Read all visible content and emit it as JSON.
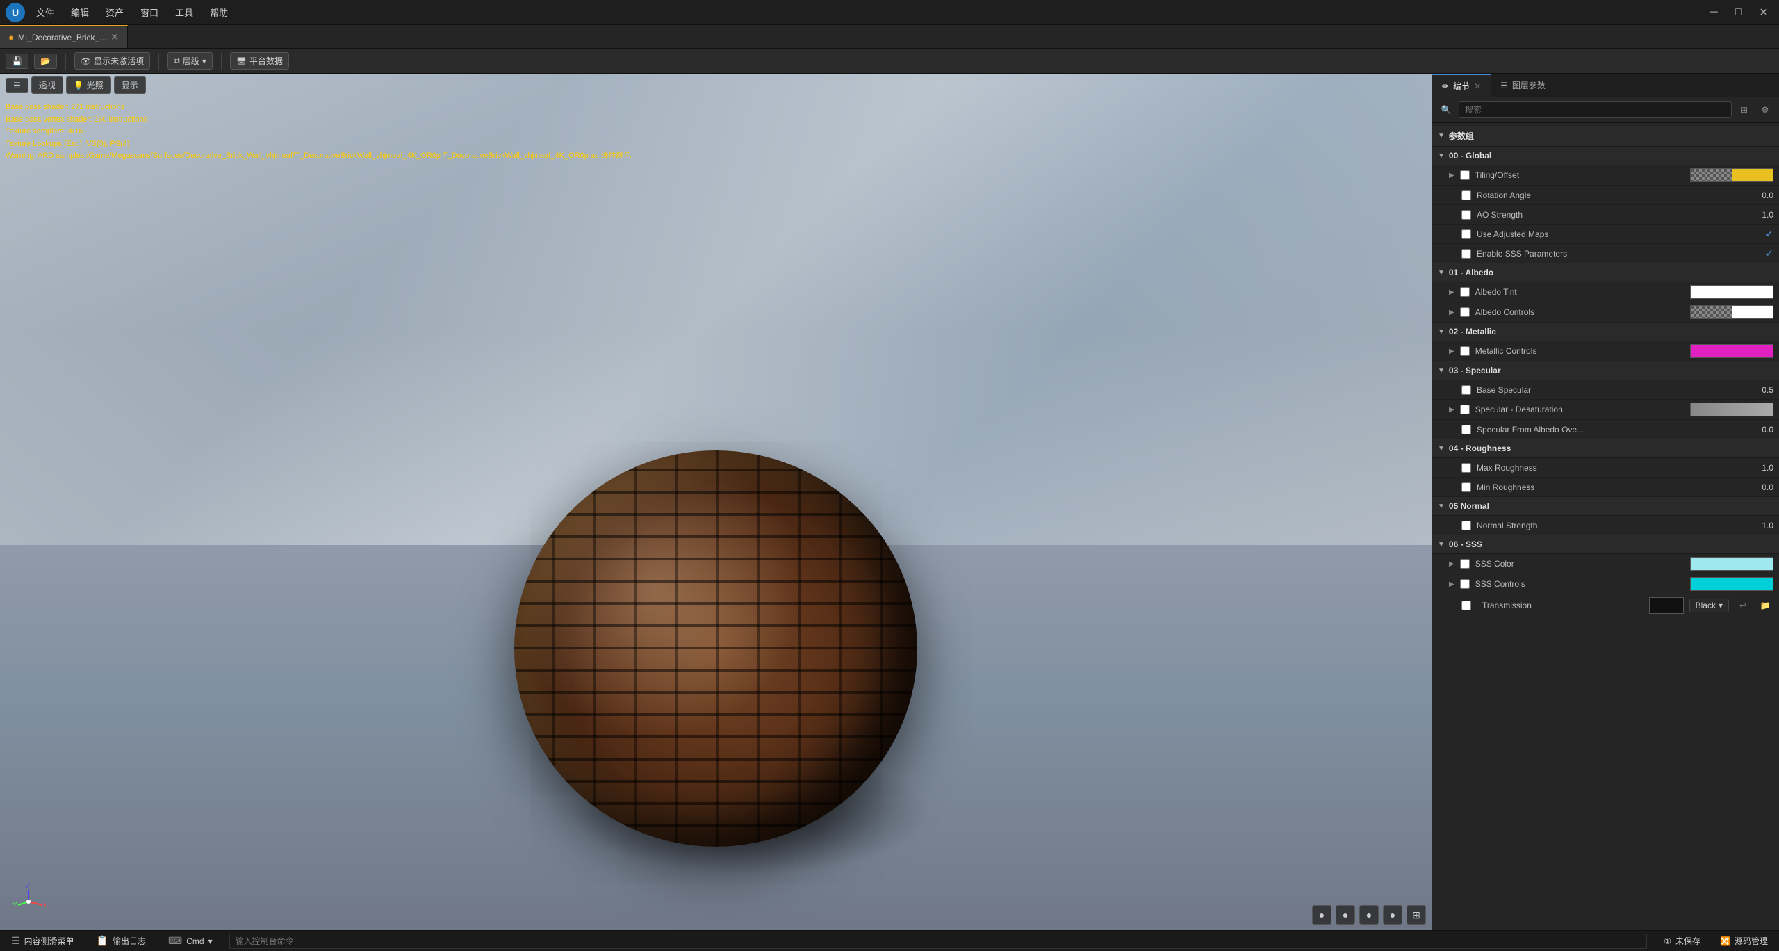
{
  "titleBar": {
    "logo": "U",
    "menus": [
      "文件",
      "编辑",
      "资产",
      "窗口",
      "工具",
      "帮助"
    ],
    "winControls": [
      "—",
      "☐",
      "✕"
    ]
  },
  "tabs": [
    {
      "label": "MI_Decorative_Brick_...",
      "active": true
    }
  ],
  "toolbar": {
    "saveBtn": "💾",
    "openBtn": "📁",
    "showUnactivated": "显示未激活项",
    "layerLabel": "层级",
    "platformData": "平台数据"
  },
  "viewport": {
    "perspBtn": "透视",
    "lightingBtn": "光照",
    "showBtn": "显示",
    "debugLines": [
      "Base pass shader: 271 instructions",
      "Base pass vertex shader: 260 instructions",
      "Texture samplers: 4/16",
      "Texture Lookups (Est.): VS(3), PS(4)"
    ],
    "warningLine": "Warning: ARD samples /Game/Megascans/Surfaces/Decorative_Brick_Wall_vhjmeaf/T_DecorativeBrickWall_vhjmeaf_4K_OR0p T_DecorativeBrickWall_vhjmeaf_4K_OR0p as 线性颜色",
    "bottomBtns": [
      "●",
      "●",
      "●",
      "●",
      "⊞"
    ]
  },
  "rightPanel": {
    "tabs": [
      {
        "label": "编节",
        "active": true,
        "icon": "✏"
      },
      {
        "label": "图层参数",
        "active": false,
        "icon": "☰"
      }
    ],
    "search": {
      "placeholder": "搜索"
    },
    "sections": {
      "header": "参数组",
      "groups": [
        {
          "id": "global",
          "label": "00 - Global",
          "expanded": true,
          "params": [
            {
              "id": "tiling",
              "label": "Tiling/Offset",
              "type": "swatch-tiling",
              "hasArrow": true
            },
            {
              "id": "rotation",
              "label": "Rotation Angle",
              "type": "number",
              "value": "0.0"
            },
            {
              "id": "ao",
              "label": "AO Strength",
              "type": "number",
              "value": "1.0"
            },
            {
              "id": "adjusted",
              "label": "Use Adjusted Maps",
              "type": "checkbox-check",
              "checked": true
            },
            {
              "id": "sss-enable",
              "label": "Enable SSS Parameters",
              "type": "checkbox-check",
              "checked": true
            }
          ]
        },
        {
          "id": "albedo",
          "label": "01 - Albedo",
          "expanded": true,
          "params": [
            {
              "id": "albedo-tint",
              "label": "Albedo Tint",
              "type": "swatch-white",
              "hasArrow": true
            },
            {
              "id": "albedo-controls",
              "label": "Albedo Controls",
              "type": "swatch-checker",
              "hasArrow": true
            }
          ]
        },
        {
          "id": "metallic",
          "label": "02 - Metallic",
          "expanded": true,
          "params": [
            {
              "id": "metallic-controls",
              "label": "Metallic Controls",
              "type": "swatch-magenta",
              "hasArrow": true
            }
          ]
        },
        {
          "id": "specular",
          "label": "03 - Specular",
          "expanded": true,
          "params": [
            {
              "id": "base-specular",
              "label": "Base Specular",
              "type": "number",
              "value": "0.5"
            },
            {
              "id": "specular-desat",
              "label": "Specular - Desaturation",
              "type": "swatch-desat",
              "hasArrow": true
            },
            {
              "id": "specular-albedo",
              "label": "Specular From Albedo Ove...",
              "type": "number",
              "value": "0.0"
            }
          ]
        },
        {
          "id": "roughness",
          "label": "04 - Roughness",
          "expanded": true,
          "params": [
            {
              "id": "max-roughness",
              "label": "Max Roughness",
              "type": "number",
              "value": "1.0"
            },
            {
              "id": "min-roughness",
              "label": "Min Roughness",
              "type": "number",
              "value": "0.0"
            }
          ]
        },
        {
          "id": "normal",
          "label": "05 Normal",
          "expanded": true,
          "params": [
            {
              "id": "normal-strength",
              "label": "Normal Strength",
              "type": "number",
              "value": "1.0"
            }
          ]
        },
        {
          "id": "sss",
          "label": "06 - SSS",
          "expanded": true,
          "params": [
            {
              "id": "sss-color",
              "label": "SSS Color",
              "type": "swatch-cyan-light",
              "hasArrow": true
            },
            {
              "id": "sss-controls",
              "label": "SSS Controls",
              "type": "swatch-cyan",
              "hasArrow": true
            }
          ]
        },
        {
          "id": "transmission",
          "label": "Transmission",
          "expanded": true,
          "params": []
        }
      ]
    }
  },
  "statusBar": {
    "items": [
      {
        "id": "content-drawer",
        "icon": "☰",
        "label": "内容侧滑菜单"
      },
      {
        "id": "output-log",
        "icon": "📋",
        "label": "输出日志"
      },
      {
        "id": "cmd",
        "icon": "⌨",
        "label": "Cmd",
        "hasArrow": true
      },
      {
        "id": "cmd-input",
        "placeholder": "输入控制台命令"
      },
      {
        "id": "save-status",
        "label": "① 未保存",
        "right": true
      },
      {
        "id": "source-mgmt",
        "label": "源码管理",
        "right": true
      }
    ]
  },
  "transmission": {
    "swatchColor": "#111111",
    "dropdownLabel": "Black"
  }
}
